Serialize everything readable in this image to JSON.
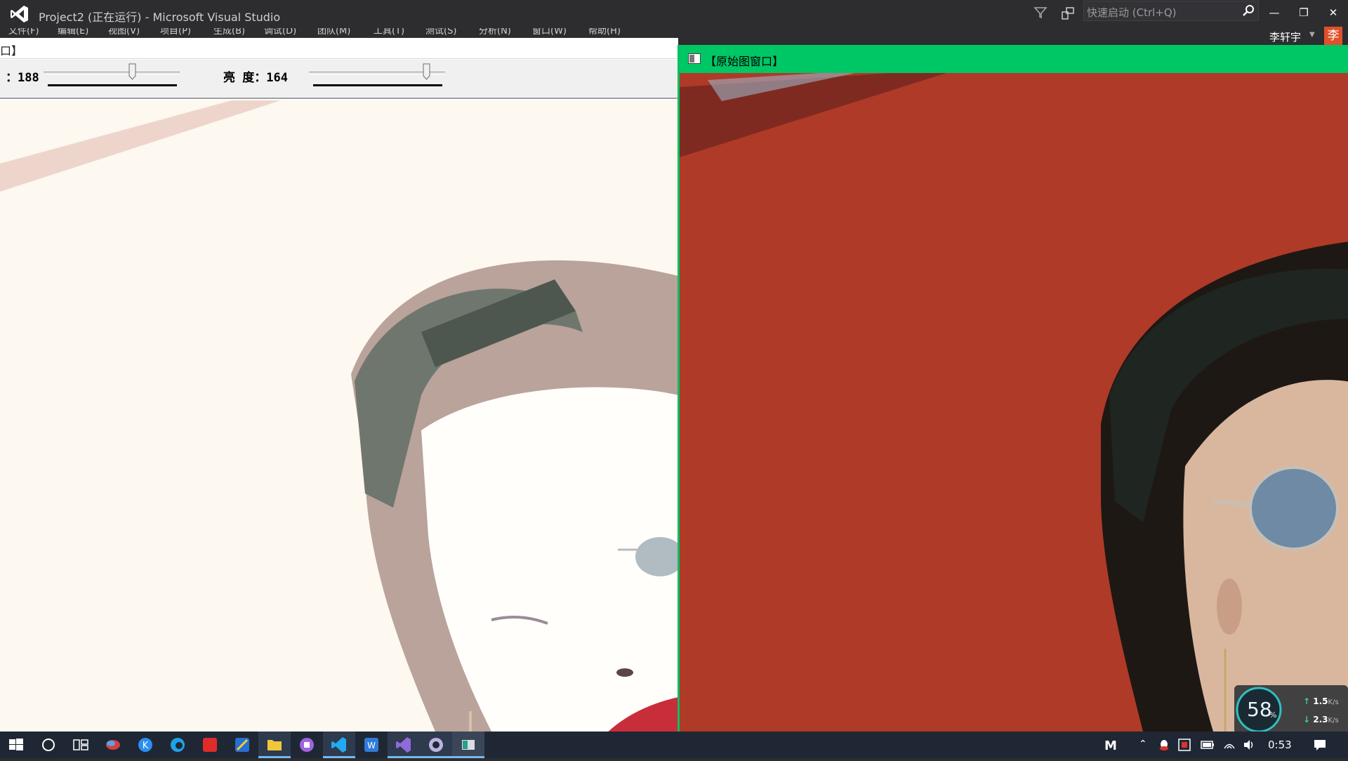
{
  "vs": {
    "title": "Project2 (正在运行) - Microsoft Visual Studio",
    "quick_launch_placeholder": "快速启动 (Ctrl+Q)",
    "user_name": "李轩宇",
    "user_avatar_char": "李",
    "menu_items": [
      "文件(F)",
      "编辑(E)",
      "视图(V)",
      "项目(P)",
      "生成(B)",
      "调试(D)",
      "团队(M)",
      "工具(T)",
      "测试(S)",
      "分析(N)",
      "窗口(W)",
      "帮助(H)"
    ]
  },
  "opencv_window": {
    "title_fragment": "口】",
    "trackbars": [
      {
        "label": "：188",
        "value": 188,
        "fill": 0.65
      },
      {
        "label": "亮  度：164",
        "value": 164,
        "fill": 0.86
      }
    ]
  },
  "original_window": {
    "title": "【原始图窗口】"
  },
  "taskbar": {
    "clock": "0:53",
    "tray_letter": "M"
  },
  "net_monitor": {
    "percent": "58",
    "percent_unit": "%",
    "upload": "1.5",
    "download": "2.3",
    "rate_unit": "K/s"
  },
  "colors": {
    "vs_bg": "#2d2d30",
    "orig_title_bg": "#00c765",
    "wall_red": "#b33a28",
    "taskbar_bg": "#1f2734"
  }
}
